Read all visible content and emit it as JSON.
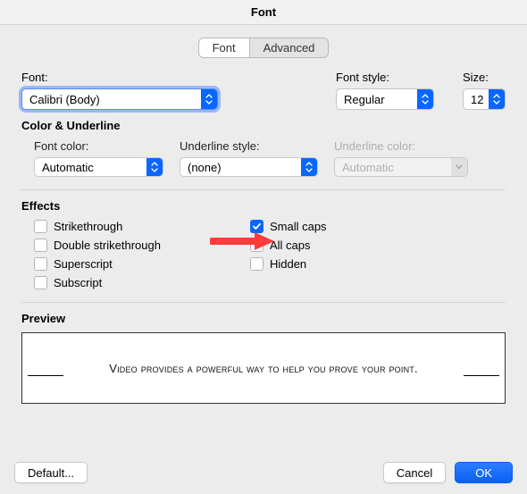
{
  "title": "Font",
  "tabs": {
    "font": "Font",
    "advanced": "Advanced"
  },
  "labels": {
    "font": "Font:",
    "fontstyle": "Font style:",
    "size": "Size:",
    "coloru": "Color & Underline",
    "fontcolor": "Font color:",
    "ustyle": "Underline style:",
    "ucolor": "Underline color:",
    "effects": "Effects",
    "preview": "Preview"
  },
  "values": {
    "font": "Calibri (Body)",
    "fontstyle": "Regular",
    "size": "12",
    "fontcolor": "Automatic",
    "ustyle": "(none)",
    "ucolor": "Automatic"
  },
  "effects": {
    "strikethrough": "Strikethrough",
    "doublestrike": "Double strikethrough",
    "superscript": "Superscript",
    "subscript": "Subscript",
    "smallcaps": "Small caps",
    "allcaps": "All caps",
    "hidden": "Hidden"
  },
  "previewText": "Video provides a powerful way to help you prove your point.",
  "buttons": {
    "default": "Default...",
    "cancel": "Cancel",
    "ok": "OK"
  }
}
